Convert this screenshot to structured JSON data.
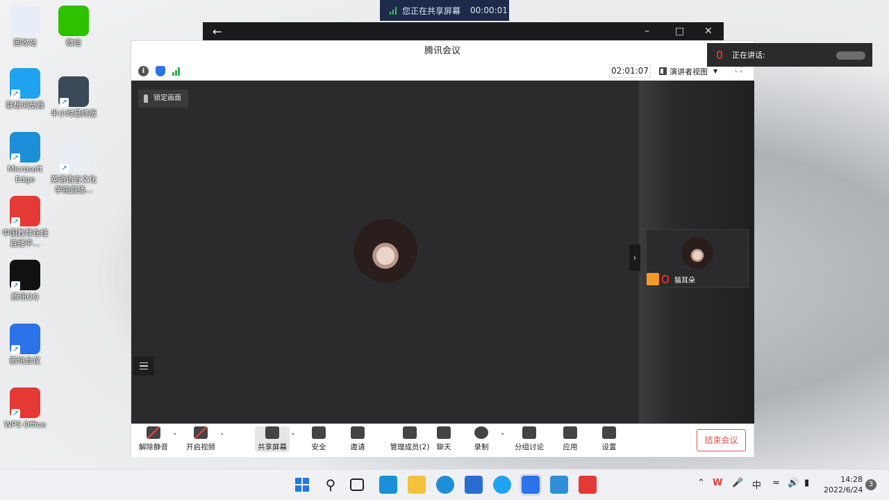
{
  "desktop": {
    "icons": [
      {
        "label": "回收站",
        "name": "recycle-bin",
        "color": "#e8eef8"
      },
      {
        "label": "微信",
        "name": "wechat",
        "color": "#2dc100"
      },
      {
        "label": "联想浏览器",
        "name": "lenovo-browser",
        "color": "#1fa3f0"
      },
      {
        "label": "半小时最终版",
        "name": "video-file",
        "color": "#3a4a58"
      },
      {
        "label": "Microsoft Edge",
        "name": "edge",
        "color": "#1c8fd8"
      },
      {
        "label": "英语语言文化学院直播...",
        "name": "ppt-file",
        "color": "#e9eef4"
      },
      {
        "label": "中国教育在线直播平...",
        "name": "edu-live",
        "color": "#e53935"
      },
      {
        "label": "腾讯QQ",
        "name": "qq",
        "color": "#111111"
      },
      {
        "label": "腾讯会议",
        "name": "tencent-meeting",
        "color": "#2a73e8"
      },
      {
        "label": "WPS Office",
        "name": "wps",
        "color": "#e53935"
      }
    ]
  },
  "share_banner": {
    "text": "您正在共享屏幕",
    "time": "00:00:01"
  },
  "meeting": {
    "title": "腾讯会议",
    "timer": "02:01:07",
    "view_label": "演讲者视图",
    "pin_label": "锁定画面",
    "participant_name": "猫耳朵",
    "toolbar": [
      {
        "label": "解除静音",
        "icon": "mic-off-icon"
      },
      {
        "label": "开启视频",
        "icon": "camera-off-icon"
      },
      {
        "label": "共享屏幕",
        "icon": "share-screen-icon"
      },
      {
        "label": "安全",
        "icon": "security-icon"
      },
      {
        "label": "邀请",
        "icon": "invite-icon"
      },
      {
        "label": "管理成员(2)",
        "icon": "members-icon"
      },
      {
        "label": "聊天",
        "icon": "chat-icon"
      },
      {
        "label": "录制",
        "icon": "record-icon"
      },
      {
        "label": "分组讨论",
        "icon": "breakout-icon"
      },
      {
        "label": "应用",
        "icon": "apps-icon"
      },
      {
        "label": "设置",
        "icon": "settings-icon"
      }
    ],
    "end_label": "结束会议"
  },
  "speaking": {
    "label": "正在讲话:"
  },
  "taskbar": {
    "ime": "中",
    "time": "14:28",
    "date": "2022/6/24",
    "notifications": "3"
  },
  "colors": {
    "accent": "#2a73e8",
    "danger": "#e05151",
    "stage": "#2b2b2e"
  }
}
